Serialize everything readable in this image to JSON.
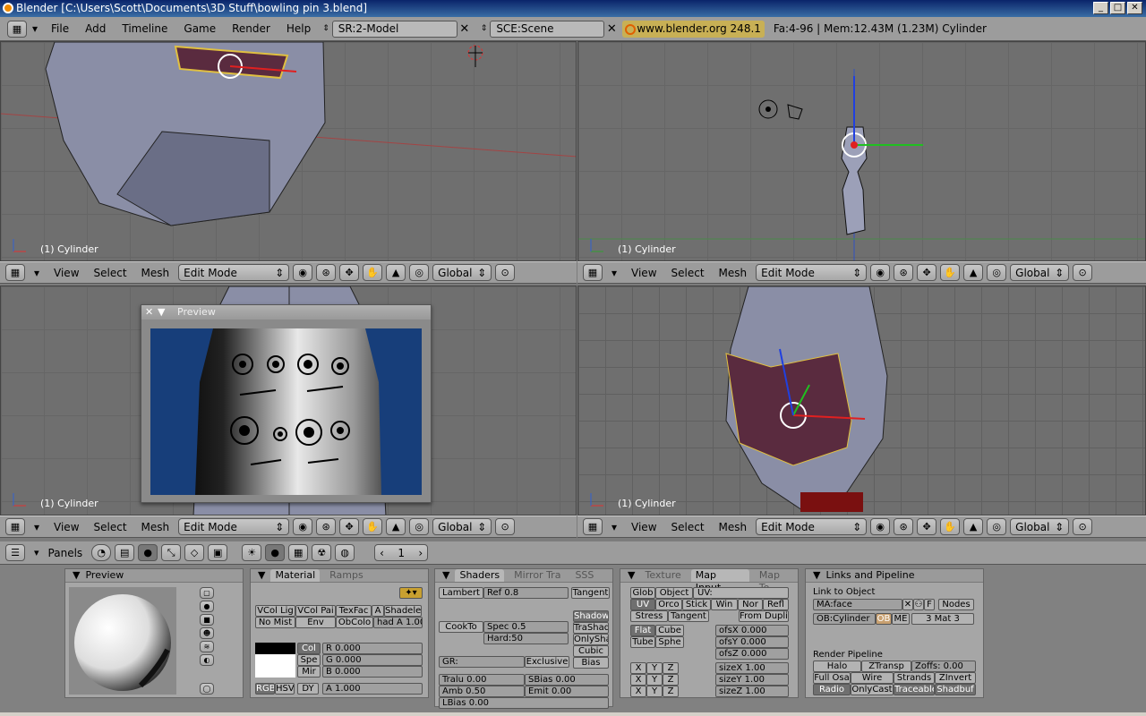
{
  "window": {
    "title": "Blender [C:\\Users\\Scott\\Documents\\3D Stuff\\bowling pin 3.blend]",
    "buttons": [
      "_",
      "□",
      "✕"
    ]
  },
  "menubar": {
    "items": [
      "File",
      "Add",
      "Timeline",
      "Game",
      "Render",
      "Help"
    ],
    "screen": "SR:2-Model",
    "scene": "SCE:Scene",
    "url": "www.blender.org 248.1",
    "stats": "Fa:4-96 | Mem:12.43M (1.23M) Cylinder"
  },
  "viewport_header": {
    "menus": [
      "View",
      "Select",
      "Mesh"
    ],
    "mode": "Edit Mode",
    "orientation": "Global"
  },
  "viewports": [
    {
      "label": "(1) Cylinder"
    },
    {
      "label": "(1) Cylinder"
    },
    {
      "label": "(1) Cylinder"
    },
    {
      "label": "(1) Cylinder"
    }
  ],
  "preview_window": {
    "title": "Preview"
  },
  "buttons_header": {
    "panels_label": "Panels",
    "frame": "1"
  },
  "panels": {
    "preview": {
      "title": "Preview"
    },
    "material": {
      "tabs": [
        "Material",
        "Ramps"
      ],
      "row1": [
        "VCol Lig",
        "VCol Pai",
        "TexFac",
        "A",
        "Shadele"
      ],
      "row2": [
        "No Mist",
        "Env",
        "ObColo",
        "had A 1.00"
      ],
      "col": "Col",
      "spe": "Spe",
      "mir": "Mir",
      "r": "R 0.000",
      "g": "G 0.000",
      "b": "B 0.000",
      "modes": [
        "RGB",
        "HSV",
        "DY"
      ],
      "alpha": "A 1.000"
    },
    "shaders": {
      "tabs": [
        "Shaders",
        "Mirror Tra",
        "SSS"
      ],
      "diffuse": "Lambert",
      "ref": "Ref  0.8",
      "tangent": "Tangent",
      "spec_shader": "CookTo",
      "spec": "Spec 0.5",
      "hard": "Hard:50",
      "toggles": [
        "Shadow",
        "TraShad",
        "OnlySha",
        "Cubic",
        "Bias"
      ],
      "gr": "GR:",
      "exclusive": "Exclusive",
      "tralu": "Tralu 0.00",
      "sbias": "SBias 0.00",
      "amb": "Amb 0.50",
      "emit": "Emit 0.00",
      "lbias": "LBias 0.00"
    },
    "texture": {
      "tabs": [
        "Texture",
        "Map Input",
        "Map To"
      ],
      "coords1": [
        "Glob",
        "Object",
        "UV:"
      ],
      "coords2": [
        "UV",
        "Orco",
        "Stick",
        "Win",
        "Nor",
        "Refl"
      ],
      "coords3": [
        "Stress",
        "Tangent",
        "From Dupli"
      ],
      "proj": [
        "Flat",
        "Cube",
        "Tube",
        "Sphe"
      ],
      "ofs": [
        "ofsX 0.000",
        "ofsY 0.000",
        "ofsZ 0.000"
      ],
      "size": [
        "sizeX 1.00",
        "sizeY 1.00",
        "sizeZ 1.00"
      ],
      "xyz": [
        "X",
        "Y",
        "Z"
      ]
    },
    "links": {
      "title": "Links and Pipeline",
      "link_to_object": "Link to Object",
      "ma": "MA:face",
      "f": "F",
      "nodes": "Nodes",
      "ob": "OB:Cylinder",
      "ob_btn": "OB",
      "me_btn": "ME",
      "mat": "3 Mat 3",
      "render_pipeline": "Render Pipeline",
      "row1": [
        "Halo",
        "ZTransp",
        "Zoffs: 0.00"
      ],
      "row2": [
        "Full Osa",
        "Wire",
        "Strands",
        "ZInvert"
      ],
      "row3": [
        "Radio",
        "OnlyCast",
        "Traceable",
        "Shadbuf"
      ]
    }
  }
}
